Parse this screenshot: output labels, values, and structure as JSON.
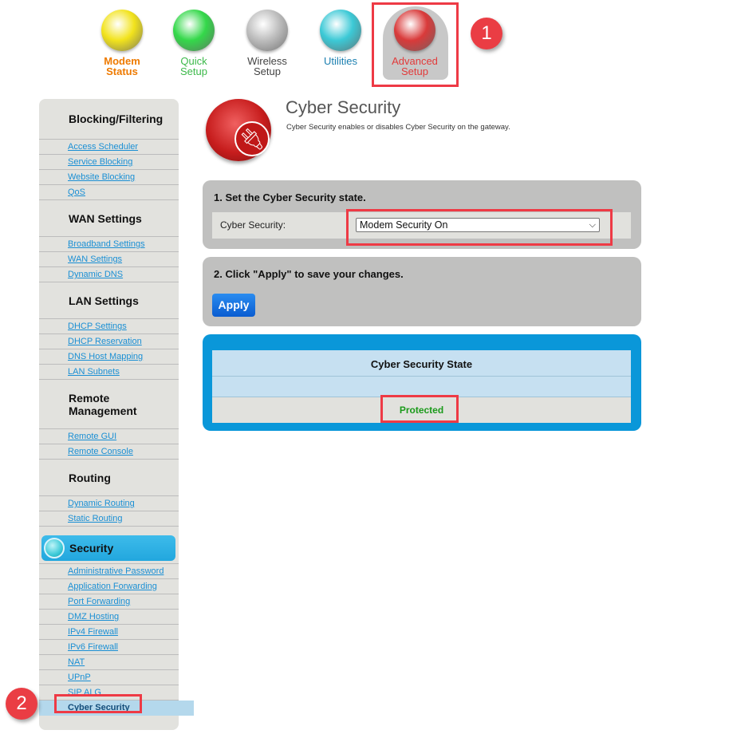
{
  "topnav": [
    {
      "label1": "Modem",
      "label2": "Status",
      "color": "#ee7a00",
      "orb": "#f2e31c"
    },
    {
      "label1": "Quick",
      "label2": "Setup",
      "color": "#3cb94a",
      "orb": "#34d84a"
    },
    {
      "label1": "Wireless",
      "label2": "Setup",
      "color": "#444444",
      "orb": "#bdbdbd"
    },
    {
      "label1": "Utilities",
      "label2": "",
      "color": "#1b7fb0",
      "orb": "#3cc9d6"
    },
    {
      "label1": "Advanced",
      "label2": "Setup",
      "color": "#e23a3a",
      "orb": "#d93a3a"
    }
  ],
  "callouts": {
    "one": "1",
    "two": "2"
  },
  "sidebar": {
    "groups": [
      {
        "title": "Blocking/Filtering",
        "items": [
          "Access Scheduler",
          "Service Blocking",
          "Website Blocking",
          "QoS"
        ]
      },
      {
        "title": "WAN Settings",
        "items": [
          "Broadband Settings",
          "WAN Settings",
          "Dynamic DNS"
        ]
      },
      {
        "title": "LAN Settings",
        "items": [
          "DHCP Settings",
          "DHCP Reservation",
          "DNS Host Mapping",
          "LAN Subnets"
        ]
      },
      {
        "title": "Remote Management",
        "items": [
          "Remote GUI",
          "Remote Console"
        ]
      },
      {
        "title": "Routing",
        "items": [
          "Dynamic Routing",
          "Static Routing"
        ]
      }
    ],
    "security": {
      "title": "Security",
      "items": [
        "Administrative Password",
        "Application Forwarding",
        "Port Forwarding",
        "DMZ Hosting",
        "IPv4 Firewall",
        "IPv6 Firewall",
        "NAT",
        "UPnP",
        "SIP ALG"
      ],
      "active": "Cyber Security"
    }
  },
  "page": {
    "title": "Cyber Security",
    "subtitle": "Cyber Security enables or disables Cyber Security on the gateway."
  },
  "step1": {
    "heading": "1. Set the Cyber Security state.",
    "label": "Cyber Security:",
    "value": "Modem Security On"
  },
  "step2": {
    "heading": "2. Click \"Apply\" to save your changes.",
    "apply": "Apply"
  },
  "state": {
    "heading": "Cyber Security State",
    "value": "Protected",
    "value_color": "#1a9a1a"
  }
}
